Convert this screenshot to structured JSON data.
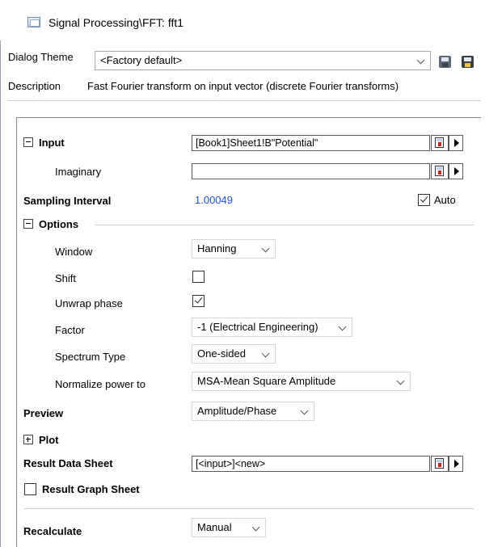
{
  "window": {
    "title": "Signal Processing\\FFT: fft1"
  },
  "header": {
    "theme_label": "Dialog Theme",
    "theme_value": "<Factory default>",
    "description_label": "Description",
    "description_text": "Fast Fourier transform on input vector (discrete Fourier transforms)"
  },
  "form": {
    "input": {
      "label": "Input",
      "value": "[Book1]Sheet1!B\"Potential\"",
      "imaginary_label": "Imaginary",
      "imaginary_value": ""
    },
    "sampling": {
      "label": "Sampling Interval",
      "value": "1.00049",
      "auto_label": "Auto",
      "auto_checked": true
    },
    "options": {
      "label": "Options",
      "window_label": "Window",
      "window_value": "Hanning",
      "shift_label": "Shift",
      "shift_checked": false,
      "unwrap_label": "Unwrap phase",
      "unwrap_checked": true,
      "factor_label": "Factor",
      "factor_value": "-1 (Electrical Engineering)",
      "spectrum_label": "Spectrum Type",
      "spectrum_value": "One-sided",
      "normalize_label": "Normalize power to",
      "normalize_value": "MSA-Mean Square Amplitude"
    },
    "preview": {
      "label": "Preview",
      "value": "Amplitude/Phase"
    },
    "plot": {
      "label": "Plot"
    },
    "result_data_sheet": {
      "label": "Result Data Sheet",
      "value": "[<input>]<new>"
    },
    "result_graph_sheet": {
      "label": "Result Graph Sheet",
      "checked": false
    },
    "recalculate": {
      "label": "Recalculate",
      "value": "Manual"
    }
  },
  "icons": {
    "app": "dialog-window-icon",
    "save": "save-theme-icon",
    "save_as": "save-theme-as-icon",
    "picker": "column-picker-icon",
    "menu_arrow": "right-arrow-icon"
  }
}
